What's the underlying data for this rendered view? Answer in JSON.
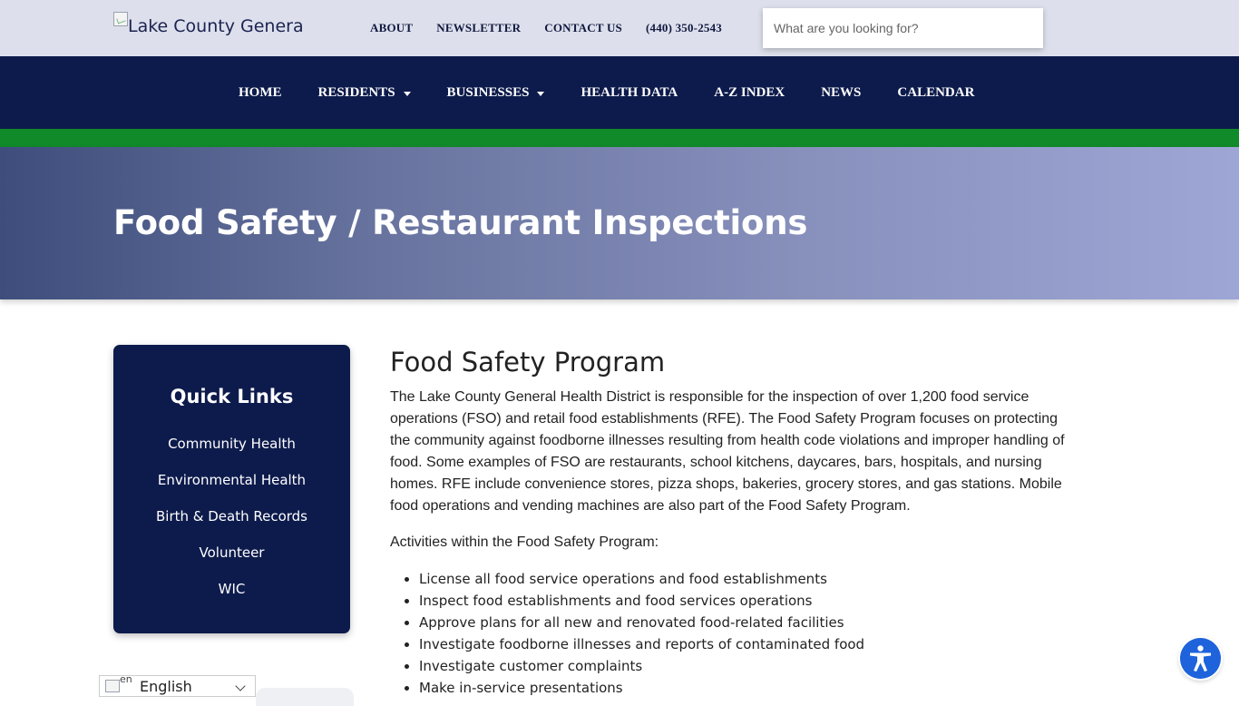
{
  "header": {
    "logo_alt": "Lake County Genera",
    "links": [
      "ABOUT",
      "NEWSLETTER",
      "CONTACT US",
      "(440) 350-2543"
    ],
    "search_placeholder": "What are you looking for?"
  },
  "nav": {
    "items": [
      {
        "label": "HOME",
        "has_dropdown": false
      },
      {
        "label": "RESIDENTS",
        "has_dropdown": true
      },
      {
        "label": "BUSINESSES",
        "has_dropdown": true
      },
      {
        "label": "HEALTH DATA",
        "has_dropdown": false
      },
      {
        "label": "A-Z INDEX",
        "has_dropdown": false
      },
      {
        "label": "NEWS",
        "has_dropdown": false
      },
      {
        "label": "CALENDAR",
        "has_dropdown": false
      }
    ]
  },
  "hero": {
    "title": "Food Safety / Restaurant Inspections"
  },
  "quick_links": {
    "title": "Quick Links",
    "items": [
      "Community Health",
      "Environmental Health",
      "Birth & Death Records",
      "Volunteer",
      "WIC"
    ]
  },
  "content": {
    "heading": "Food Safety Program",
    "intro": "The Lake County General Health District is responsible for the inspection of over 1,200 food service operations (FSO) and retail food establishments (RFE). The Food Safety Program focuses on protecting the community against foodborne illnesses resulting from health code violations and improper handling of food. Some examples of FSO are restaurants, school kitchens, daycares, bars, hospitals, and nursing homes. RFE include convenience stores, pizza shops, bakeries, grocery stores, and gas stations. Mobile food operations and vending machines are also part of the Food Safety Program.",
    "activities_label": "Activities within the Food Safety Program:",
    "activities": [
      "License all food service operations and food establishments",
      "Inspect food establishments and food services operations",
      "Approve plans for all new and renovated food-related facilities",
      "Investigate foodborne illnesses and reports of contaminated food",
      "Investigate customer complaints",
      "Make in-service presentations"
    ]
  },
  "language": {
    "code": "en",
    "label": "English"
  },
  "colors": {
    "topbar_bg": "#dde0ec",
    "nav_bg": "#0d1b4c",
    "accent_green": "#118a2a",
    "accessibility_blue": "#1e63dc"
  },
  "icons": {
    "accessibility": "accessibility-person-icon",
    "dropdown": "caret-down-icon",
    "language_chevron": "chevron-down-icon"
  }
}
